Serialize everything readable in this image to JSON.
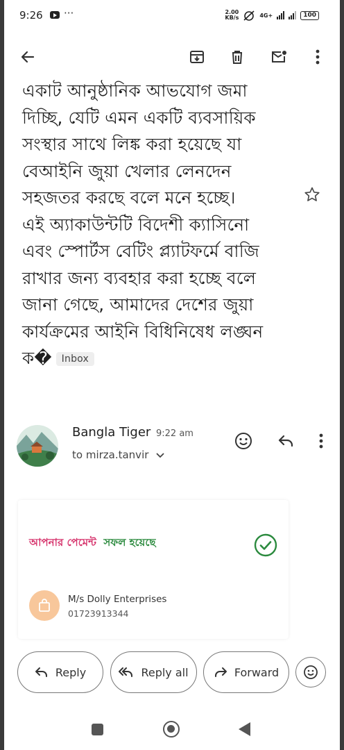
{
  "status_bar": {
    "time": "9:26",
    "dots": "···",
    "net_speed_top": "2.00",
    "net_speed_unit": "KB/s",
    "network": "4G+",
    "battery": "100"
  },
  "email": {
    "body_lines": [
      "একাট আনুষ্ঠানিক আভযোগ জমা",
      "দিচ্ছি, যেটি এমন একটি ব্যবসায়িক",
      "সংস্থার সাথে লিঙ্ক করা হয়েছে যা",
      "বেআইনি জুয়া খেলার লেনদেন",
      "সহজতর করছে বলে মনে হচ্ছে।",
      "এই অ্যাকাউন্টটি বিদেশী ক্যাসিনো",
      "এবং স্পোর্টস বেটিং প্ল্যাটফর্মে বাজি",
      "রাখার জন্য ব্যবহার করা হচ্ছে বলে",
      "জানা গেছে, আমাদের দেশের জুয়া",
      "কার্যক্রমের আইনি বিধিনিষেধ লঙ্ঘন"
    ],
    "last_line": "ক�",
    "label_chip": "Inbox",
    "sender_name": "Bangla Tiger",
    "sent_time": "9:22 am",
    "to_line": "to mirza.tanvir"
  },
  "card": {
    "title_part1": "আপনার পেমেন্ট",
    "title_part2": "সফল হয়েছে",
    "merchant_name": "M/s Dolly Enterprises",
    "merchant_phone": "01723913344"
  },
  "actions": {
    "reply": "Reply",
    "reply_all": "Reply all",
    "forward": "Forward"
  },
  "colors": {
    "title_pink": "#d6336c",
    "title_green": "#2b8a3e",
    "check_green": "#2b8a3e",
    "merchant_bg": "#f8c79b"
  },
  "icons": [
    "back-arrow-icon",
    "archive-icon",
    "delete-icon",
    "mark-unread-icon",
    "more-vert-icon",
    "star-icon",
    "emoji-icon",
    "reply-icon",
    "reply-all-icon",
    "forward-icon",
    "check-circle-icon",
    "shopping-bag-icon"
  ]
}
